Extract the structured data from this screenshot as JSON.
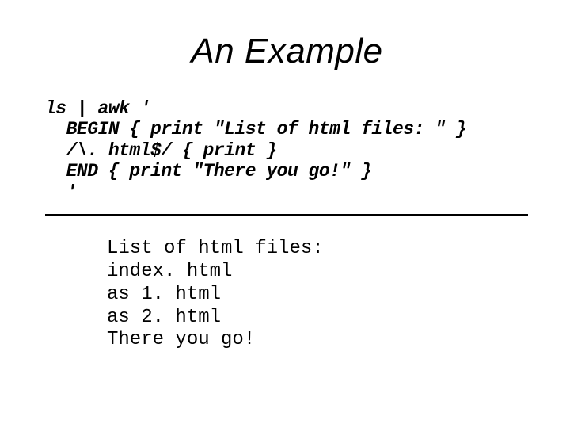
{
  "slide": {
    "title": "An Example",
    "code": "ls | awk '\n  BEGIN { print \"List of html files: \" }\n  /\\. html$/ { print }\n  END { print \"There you go!\" }\n  '",
    "output": "List of html files:\nindex. html\nas 1. html\nas 2. html\nThere you go!"
  }
}
